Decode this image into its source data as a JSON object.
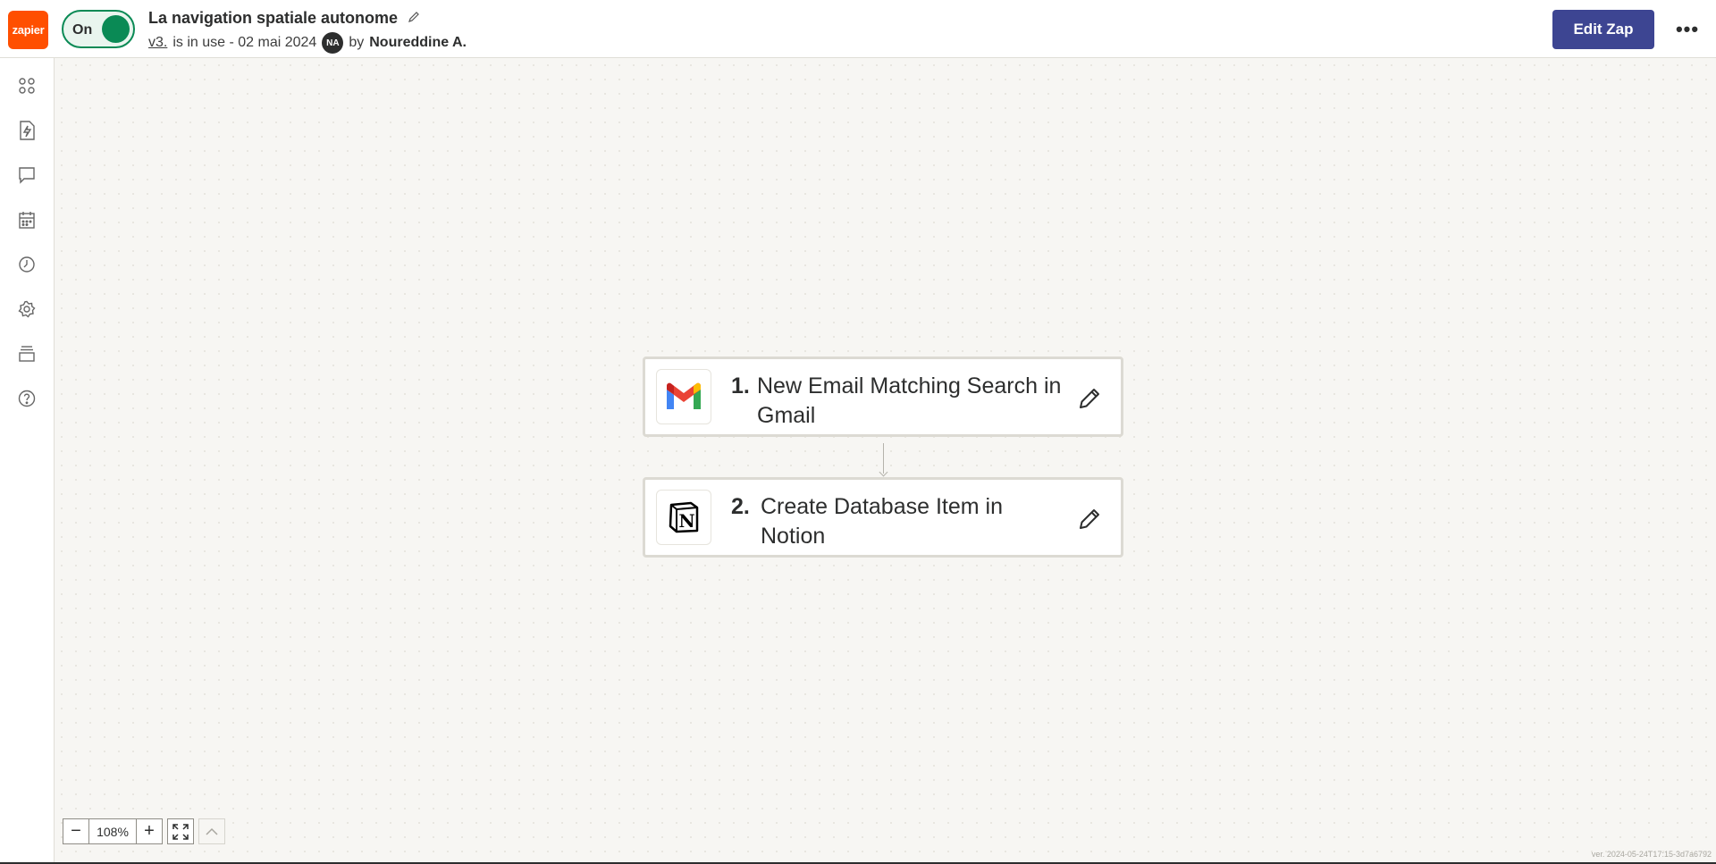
{
  "header": {
    "logo_text": "zapier",
    "toggle_label": "On",
    "zap_title": "La navigation spatiale autonome",
    "version_link": "v3.",
    "status_text": "is in use - 02 mai 2024",
    "avatar_initials": "NA",
    "by_text": "by",
    "author": "Noureddine A.",
    "edit_button": "Edit Zap",
    "more_button": "•••"
  },
  "sidebar": {
    "items": [
      {
        "icon": "apps-icon"
      },
      {
        "icon": "zap-runs-icon"
      },
      {
        "icon": "comments-icon"
      },
      {
        "icon": "calendar-icon"
      },
      {
        "icon": "history-icon"
      },
      {
        "icon": "settings-icon"
      },
      {
        "icon": "layers-icon"
      },
      {
        "icon": "help-icon"
      }
    ]
  },
  "steps": [
    {
      "number": "1.",
      "text": "New Email Matching Search in Gmail",
      "app": "gmail-icon"
    },
    {
      "number": "2.",
      "text": "Create Database Item in Notion",
      "app": "notion-icon"
    }
  ],
  "zoom": {
    "minus": "−",
    "value": "108%",
    "plus": "+"
  },
  "version_stamp": "ver. 2024-05-24T17:15-3d7a6792",
  "colors": {
    "brand_orange": "#ff4f00",
    "toggle_green": "#0a8a55",
    "edit_button": "#3d4592"
  }
}
